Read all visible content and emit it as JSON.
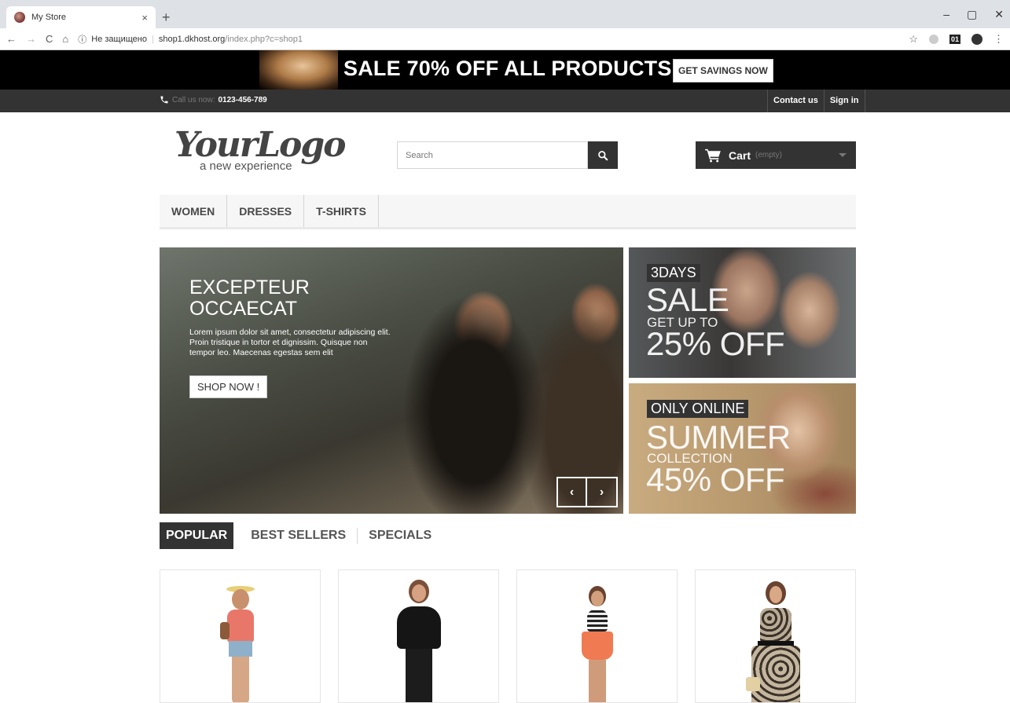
{
  "browser": {
    "tab_title": "My Store",
    "tab_close": "×",
    "new_tab": "+",
    "nav": {
      "back": "←",
      "forward": "→",
      "reload": "C",
      "home": "⌂"
    },
    "security_label": "Не защищено",
    "url_host": "shop1.dkhost.org",
    "url_path": "/index.php?c=shop1",
    "window": {
      "minimize": "–",
      "restore": "▢",
      "close": "✕"
    },
    "extension_label": "01",
    "menu_dots": "⋮",
    "star": "☆"
  },
  "promo": {
    "text": "SALE 70% OFF ALL PRODUCTS",
    "button": "GET SAVINGS NOW"
  },
  "topnav": {
    "call_label": "Call us now:",
    "phone": "0123-456-789",
    "contact": "Contact us",
    "signin": "Sign in"
  },
  "header": {
    "logo_main": "YourLogo",
    "logo_sub": "a new experience",
    "search_placeholder": "Search",
    "cart_label": "Cart",
    "cart_status": "(empty)"
  },
  "menu": [
    "WOMEN",
    "DRESSES",
    "T-SHIRTS"
  ],
  "slider": {
    "title_line1": "EXCEPTEUR",
    "title_line2": "OCCAECAT",
    "text": "Lorem ipsum dolor sit amet, consectetur adipiscing elit. Proin tristique in tortor et dignissim. Quisque non tempor leo. Maecenas egestas sem elit",
    "button": "SHOP NOW !",
    "prev": "‹",
    "next": "›"
  },
  "banners": [
    {
      "tag": "3DAYS",
      "big": "SALE",
      "small": "GET UP TO",
      "big2": "25% OFF"
    },
    {
      "tag": "ONLY ONLINE",
      "big": "SUMMER",
      "small": "COLLECTION",
      "big2": "45% OFF"
    }
  ],
  "product_tabs": [
    "POPULAR",
    "BEST SELLERS",
    "SPECIALS"
  ],
  "colors": {
    "dark": "#333333",
    "promo_bg": "#000000",
    "menu_bg": "#f6f6f6"
  }
}
